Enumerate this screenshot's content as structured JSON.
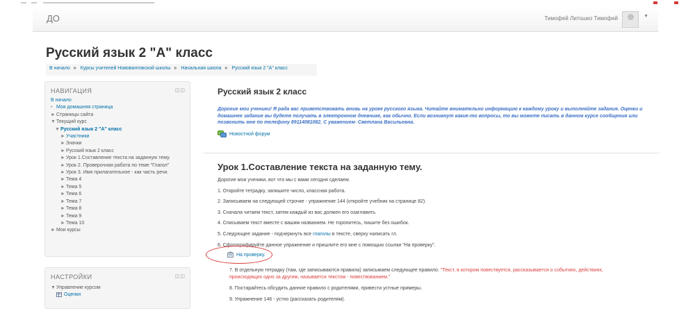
{
  "header": {
    "brand": "ДО",
    "user_name": "Тимофей Литошко Тимофей",
    "user_menu_caret": "▼"
  },
  "page": {
    "title": "Русский язык 2 \"А\" класс"
  },
  "breadcrumb": [
    "В начало",
    "Курсы учителей Нововилговской школы",
    "Начальная школа",
    "Русский язык 2 \"А\" класс"
  ],
  "breadcrumb_separator": "►",
  "navigation_block": {
    "title": "НАВИГАЦИЯ",
    "controls": "◫◫",
    "home": "В начало",
    "items": [
      {
        "marker": "•",
        "label": "Моя домашняя страница"
      },
      {
        "marker": "►",
        "label": "Страницы сайта"
      },
      {
        "marker": "▼",
        "label": "Текущий курс"
      }
    ],
    "course": {
      "marker": "▼",
      "label": "Русский язык 2 \"А\" класс"
    },
    "course_items": [
      {
        "marker": "►",
        "label": "Участники"
      },
      {
        "marker": "►",
        "label": "Значки"
      },
      {
        "marker": "►",
        "label": "Русский язык 2 класс"
      },
      {
        "marker": "►",
        "label": "Урок 1.Составление текста на заданную тему."
      },
      {
        "marker": "►",
        "label": "Урок 2. Проверочная работа по теме \"Глагол\""
      },
      {
        "marker": "►",
        "label": "Урок 3. Имя прилагательное - как часть речи."
      },
      {
        "marker": "►",
        "label": "Тема 4"
      },
      {
        "marker": "►",
        "label": "Тема 5"
      },
      {
        "marker": "►",
        "label": "Тема 6"
      },
      {
        "marker": "►",
        "label": "Тема 7"
      },
      {
        "marker": "►",
        "label": "Тема 8"
      },
      {
        "marker": "►",
        "label": "Тема 9"
      },
      {
        "marker": "►",
        "label": "Тема 10"
      }
    ],
    "my_courses": {
      "marker": "►",
      "label": "Мои курсы"
    }
  },
  "settings_block": {
    "title": "НАСТРОЙКИ",
    "controls": "◫◫",
    "manage": {
      "marker": "▼",
      "label": "Управление курсом"
    },
    "grades": "Оценки"
  },
  "section0": {
    "title": "Русский язык 2 класс",
    "welcome": "Дорогие мои ученики! Я рада вас приветствовать вновь на уроке русского языка. Читайте внимательно информацию к каждому уроку и выполняйте задания. Оценки и домашнее задание вы будете получать в электронном дневнике, как обычно. Если возникнут какие-то вопросы, то вы можете писать в данном курсе сообщения или позвонить мне по телефону 89114081082. С уважением- Светлана Васильевна.",
    "forum_link": "Новостной форум"
  },
  "lesson1": {
    "title": "Урок 1.Составление текста на заданную тему.",
    "intro": "Дорогие мои ученики, вот что мы с вами сегодня сделаем.",
    "steps": [
      "1. Откройте тетрадку, запишите число, классная работа.",
      "2. Записываем на следующей строчке - упражнение 144 (откройте учебник на странице 82).",
      "3. Сначала читаем текст, затем каждый из вас должен его озаглавить.",
      "4. Списываем текст вместе с вашим названием. Не торопитесь, пишите без ошибок."
    ],
    "step5_before": "5. Следующее задание - подчеркнуть все ",
    "step5_keyword": "глаголы",
    "step5_after": " в тексте, сверху написать гл.",
    "step6": "6. Сфотографируйте данное упражнение и пришлите его мне  с помощью ссылки  \"На проверку\".",
    "submit_link": "На проверку.",
    "step7_before": "7. В отдельную тетрадку (там, где записываются правила) записываем следующее правило:",
    "step7_rule_line1": "\"Текст, в котором повествуется, рассказывается о событиях, действиях,",
    "step7_rule_line2": "происходящих одно за другим, называется текстом - повествованием.\"",
    "step8": "8. Постарайтесь обсудить данное правило с родителями, привести устные примеры.",
    "step9": "9. Упражнение 146 - устно (рассказать родителям)."
  },
  "colors": {
    "link": "#0070a8",
    "welcome_text": "#3a6fc4",
    "rule_text": "#d94040",
    "annotation_oval": "#d93b3b"
  }
}
